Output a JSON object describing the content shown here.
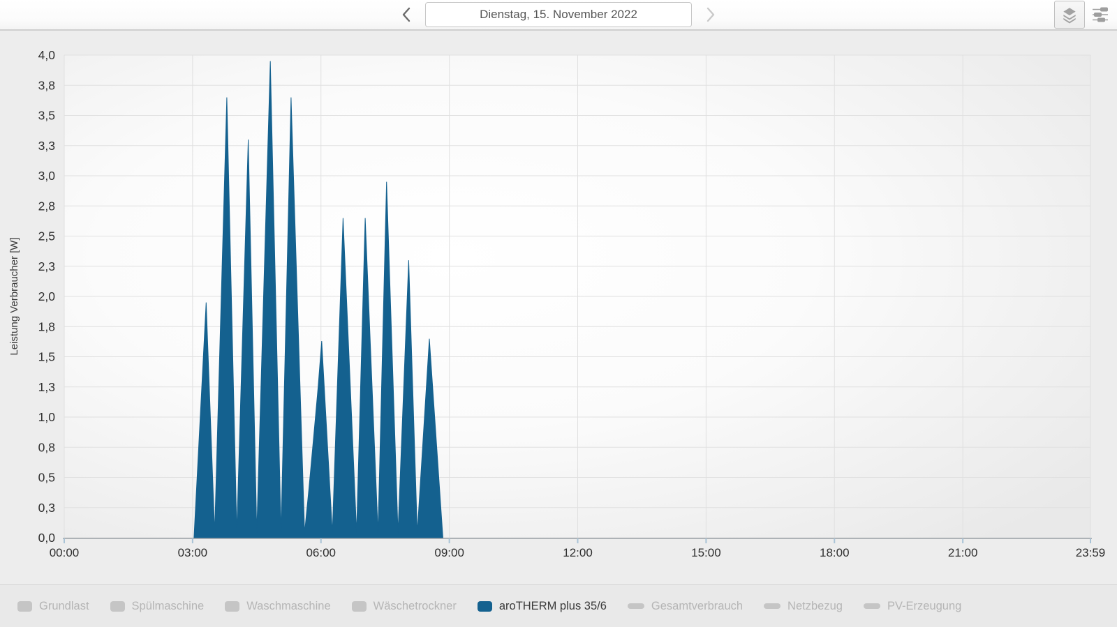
{
  "header": {
    "date_label": "Dienstag, 15. November 2022",
    "prev_icon": "chevron-left",
    "next_icon": "chevron-right",
    "layers_button_icon": "layers",
    "settings_button_icon": "sliders"
  },
  "chart_data": {
    "type": "area",
    "title": "",
    "xlabel": "",
    "ylabel": "Leistung Verbraucher [W]",
    "ylim": [
      0,
      4.0
    ],
    "xlim_minutes": [
      0,
      1439
    ],
    "grid": true,
    "legend_position": "bottom",
    "x_ticks": [
      {
        "m": 0,
        "label": "00:00"
      },
      {
        "m": 180,
        "label": "03:00"
      },
      {
        "m": 360,
        "label": "06:00"
      },
      {
        "m": 540,
        "label": "09:00"
      },
      {
        "m": 720,
        "label": "12:00"
      },
      {
        "m": 900,
        "label": "15:00"
      },
      {
        "m": 1080,
        "label": "18:00"
      },
      {
        "m": 1260,
        "label": "21:00"
      },
      {
        "m": 1439,
        "label": "23:59"
      }
    ],
    "y_ticks": [
      {
        "v": 0.0,
        "label": "0,0"
      },
      {
        "v": 0.25,
        "label": "0,3"
      },
      {
        "v": 0.5,
        "label": "0,5"
      },
      {
        "v": 0.75,
        "label": "0,8"
      },
      {
        "v": 1.0,
        "label": "1,0"
      },
      {
        "v": 1.25,
        "label": "1,3"
      },
      {
        "v": 1.5,
        "label": "1,5"
      },
      {
        "v": 1.75,
        "label": "1,8"
      },
      {
        "v": 2.0,
        "label": "2,0"
      },
      {
        "v": 2.25,
        "label": "2,3"
      },
      {
        "v": 2.5,
        "label": "2,5"
      },
      {
        "v": 2.75,
        "label": "2,8"
      },
      {
        "v": 3.0,
        "label": "3,0"
      },
      {
        "v": 3.25,
        "label": "3,3"
      },
      {
        "v": 3.5,
        "label": "3,5"
      },
      {
        "v": 3.75,
        "label": "3,8"
      },
      {
        "v": 4.0,
        "label": "4,0"
      }
    ],
    "series": [
      {
        "name": "aroTHERM plus 35/6",
        "type": "area",
        "color": "#14618f",
        "points_minutes_watts": [
          [
            182,
            0
          ],
          [
            199,
            1.95
          ],
          [
            211,
            0.04
          ],
          [
            228,
            3.65
          ],
          [
            242,
            0.04
          ],
          [
            258,
            3.3
          ],
          [
            270,
            0.04
          ],
          [
            289,
            3.95
          ],
          [
            304,
            0.04
          ],
          [
            318,
            3.65
          ],
          [
            337,
            0.04
          ],
          [
            343,
            0.4
          ],
          [
            350,
            0.85
          ],
          [
            356,
            1.25
          ],
          [
            361,
            1.63
          ],
          [
            376,
            0.04
          ],
          [
            391,
            2.65
          ],
          [
            410,
            0.04
          ],
          [
            422,
            2.65
          ],
          [
            440,
            0.04
          ],
          [
            452,
            2.95
          ],
          [
            468,
            0.04
          ],
          [
            483,
            2.3
          ],
          [
            495,
            0.04
          ],
          [
            512,
            1.65
          ],
          [
            531,
            0
          ]
        ]
      }
    ]
  },
  "legend": {
    "items": [
      {
        "label": "Grundlast",
        "swatch": "area",
        "active": false
      },
      {
        "label": "Spülmaschine",
        "swatch": "area",
        "active": false
      },
      {
        "label": "Waschmaschine",
        "swatch": "area",
        "active": false
      },
      {
        "label": "Wäschetrockner",
        "swatch": "area",
        "active": false
      },
      {
        "label": "aroTHERM plus 35/6",
        "swatch": "area",
        "active": true
      },
      {
        "label": "Gesamtverbrauch",
        "swatch": "line",
        "active": false
      },
      {
        "label": "Netzbezug",
        "swatch": "line",
        "active": false
      },
      {
        "label": "PV-Erzeugung",
        "swatch": "line",
        "active": false
      }
    ]
  },
  "colors": {
    "accent_blue": "#14618f",
    "disabled_swatch": "#c5c5c5",
    "disabled_text": "#b5b5b5",
    "active_text": "#3a3a3a",
    "gridline": "#e0e0e0",
    "axis_line": "#9aa0a5",
    "axis_tick": "#a9c3d6",
    "tick_text": "#2f2f2f"
  }
}
